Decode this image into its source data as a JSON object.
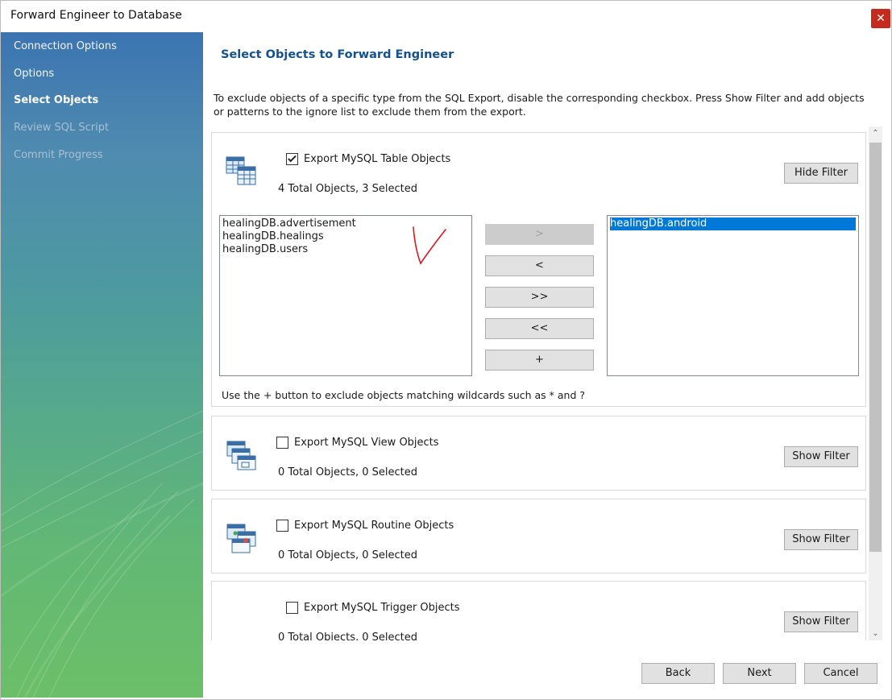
{
  "window": {
    "title": "Forward Engineer to Database",
    "close_glyph": "✕"
  },
  "sidebar": {
    "items": [
      {
        "label": "Connection Options",
        "state": "normal"
      },
      {
        "label": "Options",
        "state": "normal"
      },
      {
        "label": "Select Objects",
        "state": "active"
      },
      {
        "label": "Review SQL Script",
        "state": "disabled"
      },
      {
        "label": "Commit Progress",
        "state": "disabled"
      }
    ]
  },
  "main": {
    "title": "Select Objects to Forward Engineer",
    "description": "To exclude objects of a specific type from the SQL Export, disable the corresponding checkbox. Press Show Filter and add objects or patterns to the ignore list to exclude them from the export."
  },
  "groups": {
    "tables": {
      "icon": "table-objects-icon",
      "checkbox_label": "Export MySQL Table Objects",
      "checked": true,
      "count": "4 Total Objects, 3 Selected",
      "filter_button": "Hide Filter",
      "left_list": [
        "healingDB.advertisement",
        "healingDB.healings",
        "healingDB.users"
      ],
      "right_list": [
        "healingDB.android"
      ],
      "move_buttons": {
        "move_right": ">",
        "move_left": "<",
        "move_all_right": ">>",
        "move_all_left": "<<",
        "add_pattern": "+"
      },
      "hint": "Use the + button to exclude objects matching wildcards such as * and ?"
    },
    "views": {
      "icon": "view-objects-icon",
      "checkbox_label": "Export MySQL View Objects",
      "checked": false,
      "count": "0 Total Objects, 0 Selected",
      "filter_button": "Show Filter"
    },
    "routines": {
      "icon": "routine-objects-icon",
      "checkbox_label": "Export MySQL Routine Objects",
      "checked": false,
      "count": "0 Total Objects, 0 Selected",
      "filter_button": "Show Filter"
    },
    "triggers": {
      "checkbox_label": "Export MySQL Trigger Objects",
      "checked": false,
      "count": "0 Total Objects, 0 Selected",
      "filter_button": "Show Filter"
    }
  },
  "scrollbar": {
    "up_glyph": "⌃",
    "down_glyph": "⌄"
  },
  "footer": {
    "back": "Back",
    "next": "Next",
    "cancel": "Cancel"
  },
  "colors": {
    "accent_title": "#13528f",
    "selection": "#0078d7",
    "close": "#c42b1c",
    "annotation": "#e0141e"
  }
}
